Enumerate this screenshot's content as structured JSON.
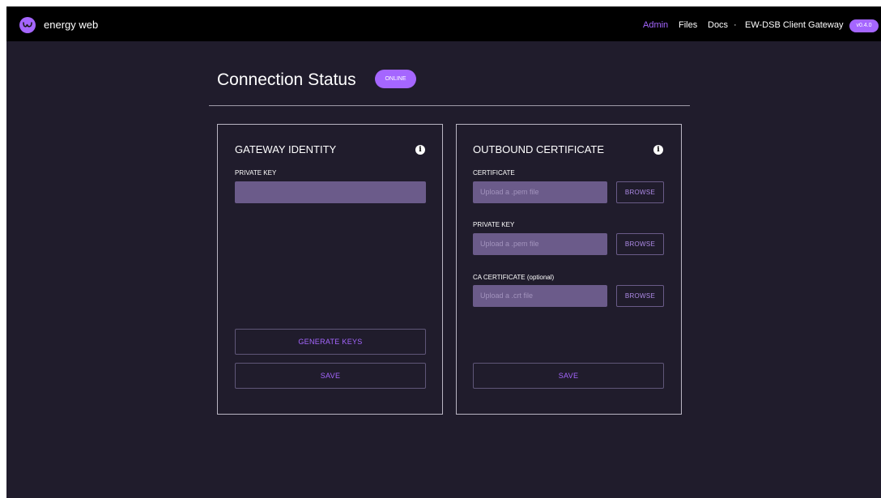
{
  "colors": {
    "accent": "#a566ff",
    "background": "#201c2c",
    "topbar": "#000000",
    "input_fill": "#6b5b8a"
  },
  "header": {
    "logo_icon": "energy-web-logo-icon",
    "brand": "energy web",
    "nav": {
      "admin": "Admin",
      "files": "Files",
      "docs": "Docs",
      "separator": "·",
      "gateway": "EW-DSB Client Gateway"
    },
    "version": "v0.4.0"
  },
  "main": {
    "title": "Connection Status",
    "status": "ONLINE"
  },
  "gateway_identity": {
    "title": "GATEWAY IDENTITY",
    "info_icon": "i",
    "private_key_label": "PRIVATE KEY",
    "private_key_value": "",
    "generate_label": "GENERATE KEYS",
    "save_label": "SAVE"
  },
  "outbound_certificate": {
    "title": "OUTBOUND CERTIFICATE",
    "info_icon": "i",
    "certificate_label": "CERTIFICATE",
    "certificate_placeholder": "Upload a .pem file",
    "private_key_label": "PRIVATE KEY",
    "private_key_placeholder": "Upload a .pem file",
    "ca_label": "CA CERTIFICATE (optional)",
    "ca_placeholder": "Upload a .crt file",
    "browse_label": "BROWSE",
    "save_label": "SAVE"
  }
}
